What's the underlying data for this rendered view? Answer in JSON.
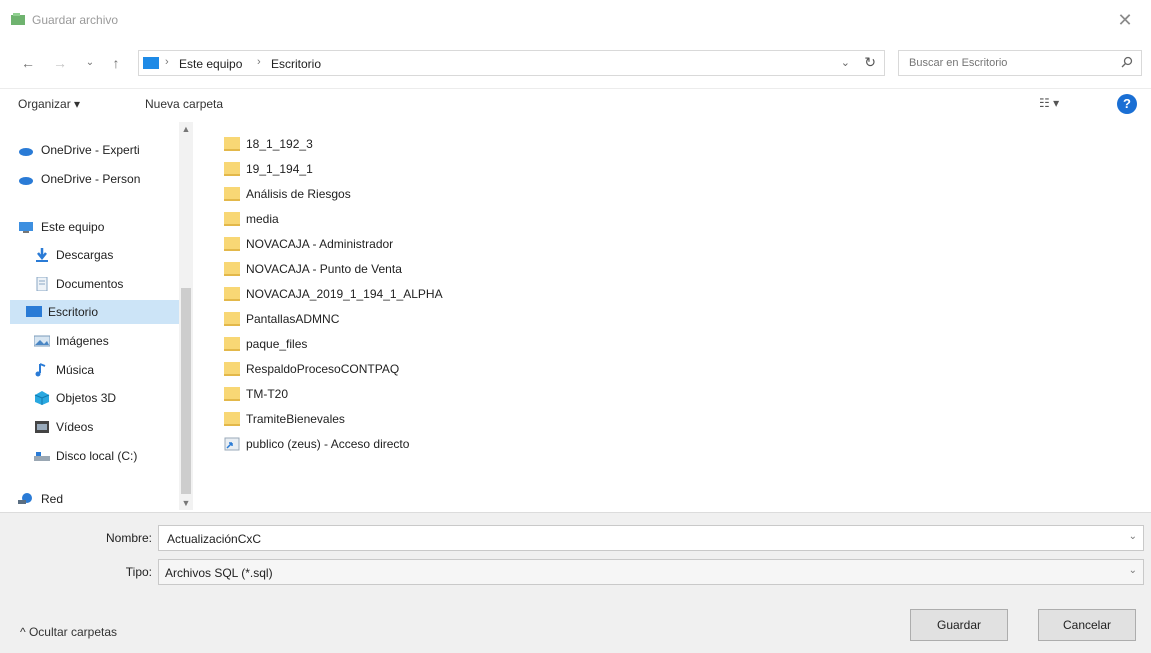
{
  "window": {
    "title": "Guardar archivo",
    "close": "✕"
  },
  "nav": {
    "back": "←",
    "forward": "→",
    "recent": "⌄",
    "up": "↑",
    "breadcrumb": [
      "Este equipo",
      "Escritorio"
    ],
    "separator": "›",
    "search_placeholder": "Buscar en Escritorio"
  },
  "toolbar": {
    "organize": "Organizar ▾",
    "new_folder": "Nueva carpeta",
    "help": "?"
  },
  "sidebar": {
    "items": [
      {
        "label": "OneDrive - Experti",
        "icon": "cloud-icon"
      },
      {
        "label": "OneDrive - Person",
        "icon": "cloud-icon"
      },
      {
        "label": "Este equipo",
        "icon": "pc-icon"
      },
      {
        "label": "Descargas",
        "icon": "download-icon"
      },
      {
        "label": "Documentos",
        "icon": "document-icon"
      },
      {
        "label": "Escritorio",
        "icon": "desktop-icon"
      },
      {
        "label": "Imágenes",
        "icon": "image-icon"
      },
      {
        "label": "Música",
        "icon": "music-icon"
      },
      {
        "label": "Objetos 3D",
        "icon": "cube-icon"
      },
      {
        "label": "Vídeos",
        "icon": "video-icon"
      },
      {
        "label": "Disco local (C:)",
        "icon": "drive-icon"
      },
      {
        "label": "Red",
        "icon": "network-icon"
      }
    ]
  },
  "files": [
    "18_1_192_3",
    "19_1_194_1",
    "Análisis de Riesgos",
    "media",
    "NOVACAJA - Administrador",
    "NOVACAJA - Punto de Venta",
    "NOVACAJA_2019_1_194_1_ALPHA",
    "PantallasADMNC",
    "paque_files",
    "RespaldoProcesoCONTPAQ",
    "TM-T20",
    "TramiteBienevales",
    "publico (zeus) - Acceso directo"
  ],
  "form": {
    "name_label": "Nombre:",
    "name_value": "ActualizaciónCxC",
    "type_label": "Tipo:",
    "type_value": "Archivos SQL (*.sql)",
    "hide_folders": "^ Ocultar carpetas",
    "save": "Guardar",
    "cancel": "Cancelar"
  },
  "colors": {
    "accent": "#1a6fd4",
    "selection": "#cce4f7",
    "folder": "#f8d775"
  }
}
